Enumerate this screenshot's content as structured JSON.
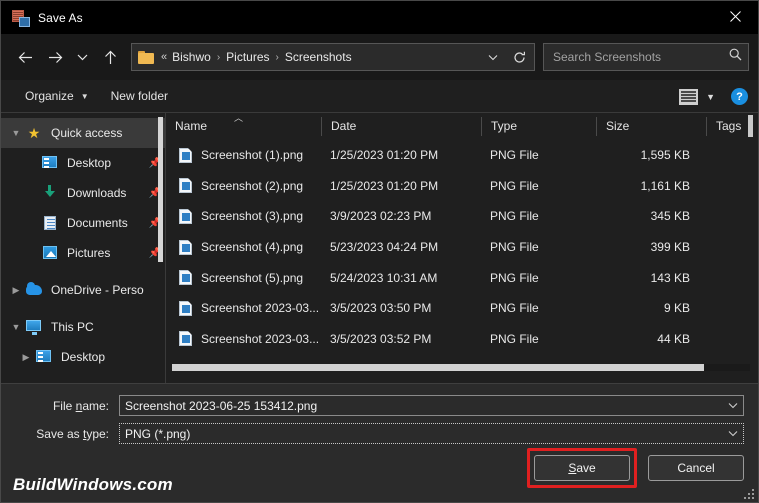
{
  "window": {
    "title": "Save As",
    "app_icon": "save-as-icon",
    "close_label": "close-icon"
  },
  "nav": {
    "back": "back-arrow-icon",
    "forward": "forward-arrow-icon",
    "recent": "recent-locations-icon",
    "up": "up-arrow-icon"
  },
  "address": {
    "folder_icon": "folder-icon",
    "prefix": "«",
    "crumbs": [
      "Bishwo",
      "Pictures",
      "Screenshots"
    ],
    "separator": "›",
    "dropdown_icon": "chevron-down-icon",
    "refresh_icon": "refresh-icon"
  },
  "search": {
    "placeholder": "Search Screenshots",
    "icon": "search-icon"
  },
  "commandbar": {
    "organize": "Organize",
    "new_folder": "New folder",
    "view_icon": "list-view-icon",
    "view_caret": "chevron-down-icon",
    "help_icon": "help-icon",
    "help_glyph": "?"
  },
  "sidebar": {
    "items": [
      {
        "label": "Quick access",
        "icon": "star-icon",
        "expander": "chevron-down-icon",
        "level": 1,
        "selected": true,
        "pinned": false
      },
      {
        "label": "Desktop",
        "icon": "desktop-icon",
        "expander": "",
        "level": 2,
        "selected": false,
        "pinned": true
      },
      {
        "label": "Downloads",
        "icon": "downloads-icon",
        "expander": "",
        "level": 2,
        "selected": false,
        "pinned": true
      },
      {
        "label": "Documents",
        "icon": "documents-icon",
        "expander": "",
        "level": 2,
        "selected": false,
        "pinned": true
      },
      {
        "label": "Pictures",
        "icon": "pictures-icon",
        "expander": "",
        "level": 2,
        "selected": false,
        "pinned": true
      },
      {
        "label": "OneDrive - Perso",
        "icon": "onedrive-icon",
        "expander": "chevron-right-icon",
        "level": 1,
        "selected": false,
        "pinned": false
      },
      {
        "label": "This PC",
        "icon": "this-pc-icon",
        "expander": "chevron-down-icon",
        "level": 1,
        "selected": false,
        "pinned": false
      },
      {
        "label": "Desktop",
        "icon": "desktop-icon",
        "expander": "chevron-right-icon",
        "level": 2,
        "selected": false,
        "pinned": false
      }
    ],
    "pin_glyph": "📌"
  },
  "filelist": {
    "columns": [
      {
        "key": "name",
        "label": "Name",
        "sorted": true,
        "sort_caret": "⌃"
      },
      {
        "key": "date",
        "label": "Date",
        "sorted": false
      },
      {
        "key": "type",
        "label": "Type",
        "sorted": false
      },
      {
        "key": "size",
        "label": "Size",
        "sorted": false
      },
      {
        "key": "tags",
        "label": "Tags",
        "sorted": false
      }
    ],
    "rows": [
      {
        "name": "Screenshot (1).png",
        "date": "1/25/2023 01:20 PM",
        "type": "PNG File",
        "size": "1,595 KB",
        "tags": ""
      },
      {
        "name": "Screenshot (2).png",
        "date": "1/25/2023 01:20 PM",
        "type": "PNG File",
        "size": "1,161 KB",
        "tags": ""
      },
      {
        "name": "Screenshot (3).png",
        "date": "3/9/2023 02:23 PM",
        "type": "PNG File",
        "size": "345 KB",
        "tags": ""
      },
      {
        "name": "Screenshot (4).png",
        "date": "5/23/2023 04:24 PM",
        "type": "PNG File",
        "size": "399 KB",
        "tags": ""
      },
      {
        "name": "Screenshot (5).png",
        "date": "5/24/2023 10:31 AM",
        "type": "PNG File",
        "size": "143 KB",
        "tags": ""
      },
      {
        "name": "Screenshot 2023-03...",
        "date": "3/5/2023 03:50 PM",
        "type": "PNG File",
        "size": "9 KB",
        "tags": ""
      },
      {
        "name": "Screenshot 2023-03...",
        "date": "3/5/2023 03:52 PM",
        "type": "PNG File",
        "size": "44 KB",
        "tags": ""
      }
    ]
  },
  "form": {
    "filename_label_pre": "File ",
    "filename_label_accel": "n",
    "filename_label_post": "ame:",
    "filename_value": "Screenshot 2023-06-25 153412.png",
    "filetype_label_pre": "Save as ",
    "filetype_label_accel": "t",
    "filetype_label_post": "ype:",
    "filetype_value": "PNG (*.png)",
    "dropdown_icon": "chevron-down-icon"
  },
  "actions": {
    "save_pre": "",
    "save_accel": "S",
    "save_post": "ave",
    "cancel": "Cancel",
    "highlight_color": "#e02020"
  },
  "watermark": "BuildWindows.com"
}
